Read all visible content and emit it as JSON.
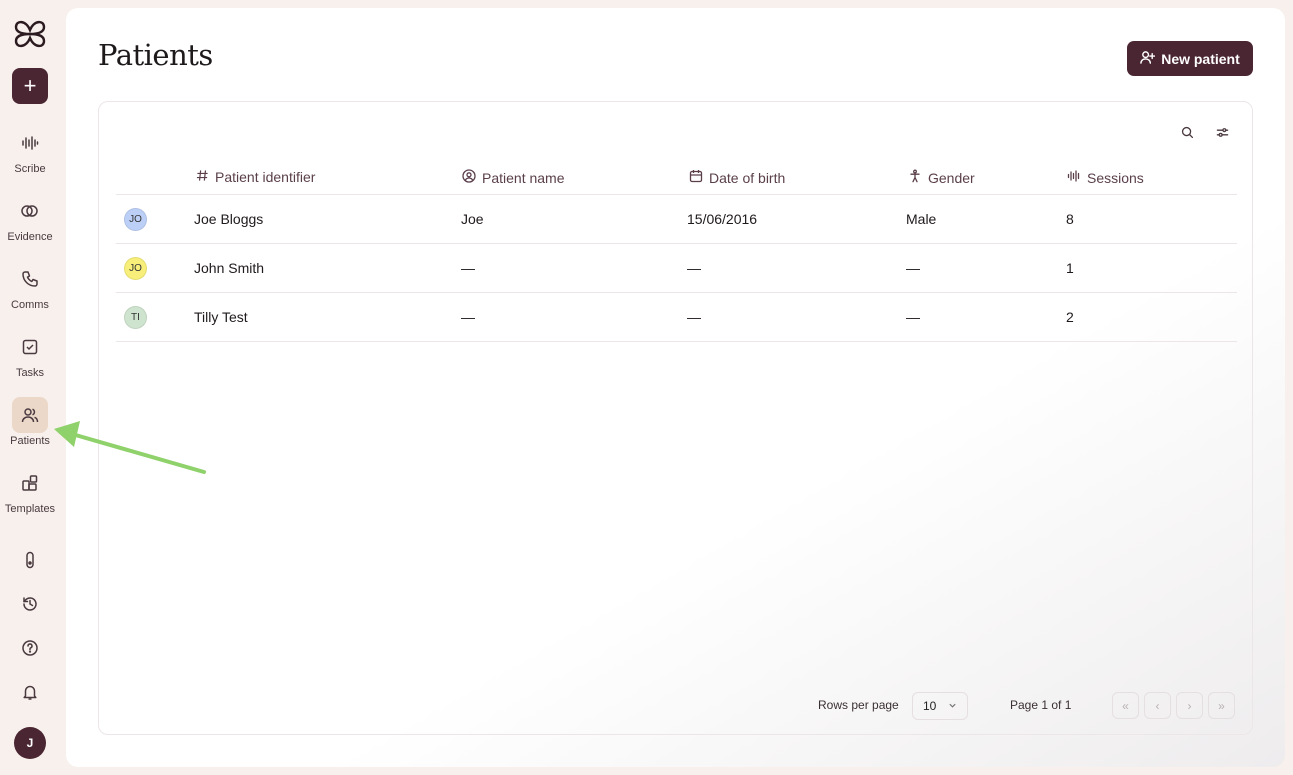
{
  "sidebar": {
    "nav": [
      {
        "label": "Scribe",
        "icon": "waveform-icon"
      },
      {
        "label": "Evidence",
        "icon": "evidence-icon"
      },
      {
        "label": "Comms",
        "icon": "phone-icon"
      },
      {
        "label": "Tasks",
        "icon": "checkbox-icon"
      },
      {
        "label": "Patients",
        "icon": "users-icon",
        "active": true
      },
      {
        "label": "Templates",
        "icon": "templates-icon"
      }
    ],
    "utility_icons": [
      "thermometer-icon",
      "history-icon",
      "help-icon",
      "bell-icon"
    ],
    "user_initial": "J"
  },
  "header": {
    "title": "Patients",
    "new_patient_label": "New patient"
  },
  "table": {
    "columns": [
      {
        "label": "Patient identifier",
        "icon": "hash-icon"
      },
      {
        "label": "Patient name",
        "icon": "user-circle-icon"
      },
      {
        "label": "Date of birth",
        "icon": "calendar-icon"
      },
      {
        "label": "Gender",
        "icon": "person-icon"
      },
      {
        "label": "Sessions",
        "icon": "waveform-icon"
      }
    ],
    "rows": [
      {
        "initials": "JO",
        "avatar_color": "#bcd0f7",
        "identifier": "Joe Bloggs",
        "name": "Joe",
        "dob": "15/06/2016",
        "gender": "Male",
        "sessions": "8"
      },
      {
        "initials": "JO",
        "avatar_color": "#f7ef7a",
        "identifier": "John Smith",
        "name": "—",
        "dob": "—",
        "gender": "—",
        "sessions": "1"
      },
      {
        "initials": "TI",
        "avatar_color": "#cfe4cf",
        "identifier": "Tilly Test",
        "name": "—",
        "dob": "—",
        "gender": "—",
        "sessions": "2"
      }
    ]
  },
  "pagination": {
    "rows_per_page_label": "Rows per page",
    "rows_per_page_value": "10",
    "page_label": "Page 1 of 1",
    "buttons": [
      "«",
      "‹",
      "›",
      "»"
    ]
  },
  "colors": {
    "brand": "#4a2532",
    "active_nav": "#ecd8c8",
    "annotation_arrow": "#8fd16a"
  }
}
